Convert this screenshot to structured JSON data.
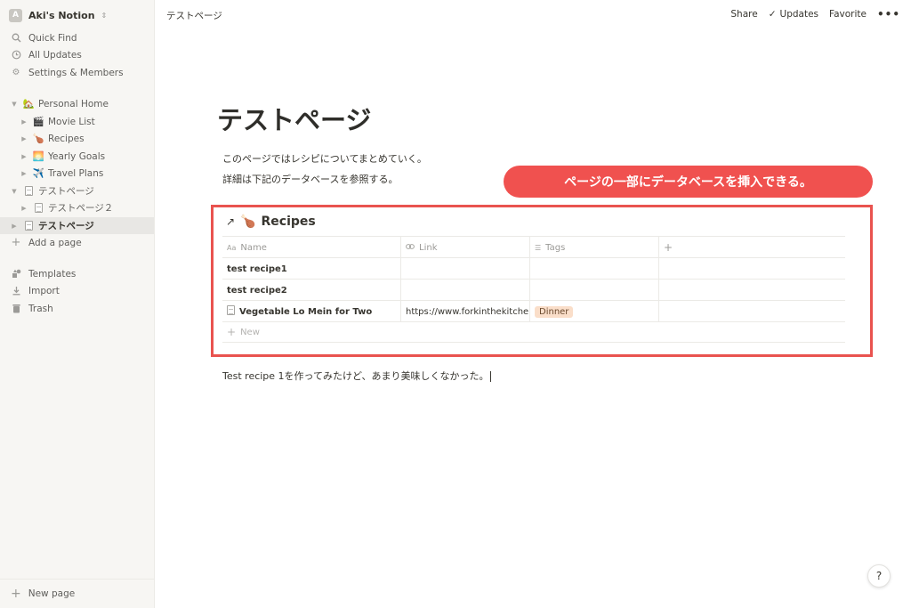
{
  "workspace": {
    "avatar": "A",
    "name": "Aki's Notion",
    "chevron_icon": "chevron-updown-icon"
  },
  "sidebar": {
    "top_items": [
      {
        "label": "Quick Find",
        "icon": "search-icon"
      },
      {
        "label": "All Updates",
        "icon": "clock-icon"
      },
      {
        "label": "Settings & Members",
        "icon": "gear-icon"
      }
    ],
    "pages": [
      {
        "label": "Personal Home",
        "emoji": "🏡",
        "expanded": true
      },
      {
        "label": "Movie List",
        "emoji": "🎬"
      },
      {
        "label": "Recipes",
        "emoji": "🍗"
      },
      {
        "label": "Yearly Goals",
        "emoji": "🌅"
      },
      {
        "label": "Travel Plans",
        "emoji": "✈️"
      },
      {
        "label": "テストページ",
        "icon": "page-icon",
        "expanded": true
      },
      {
        "label": "テストページ２",
        "icon": "page-icon"
      },
      {
        "label": "テストページ",
        "icon": "page-icon",
        "selected": true
      }
    ],
    "add_page": "Add a page",
    "bottom_items": [
      {
        "label": "Templates",
        "icon": "templates-icon"
      },
      {
        "label": "Import",
        "icon": "import-icon"
      },
      {
        "label": "Trash",
        "icon": "trash-icon"
      }
    ],
    "new_page": "New page"
  },
  "topbar": {
    "breadcrumb": "テストページ",
    "share": "Share",
    "updates": "Updates",
    "favorite": "Favorite",
    "more": "•••"
  },
  "page": {
    "title": "テストページ",
    "paragraphs": [
      "このページではレシピについてまとめていく。",
      "詳細は下記のデータベースを参照する。"
    ],
    "callout": "ページの一部にデータベースを挿入できる。",
    "closing": "Test recipe 1を作ってみたけど、あまり美味しくなかった。"
  },
  "database": {
    "link_arrow": "↗",
    "emoji": "🍗",
    "title": "Recipes",
    "headers": [
      {
        "icon": "Aa",
        "label": "Name"
      },
      {
        "icon": "link-icon",
        "label": "Link"
      },
      {
        "icon": "list-icon",
        "label": "Tags"
      },
      {
        "icon": "plus-icon",
        "label": "+"
      }
    ],
    "rows": [
      {
        "name": "test recipe1",
        "link": "",
        "tag": ""
      },
      {
        "name": "test recipe2",
        "link": "",
        "tag": ""
      },
      {
        "name": "Vegetable Lo Mein for Two",
        "link": "https://www.forkinthekitchen.c",
        "tag": "Dinner",
        "has_page_icon": true
      }
    ],
    "new_label": "New"
  },
  "help": "?",
  "colors": {
    "accent_red": "#f0514f",
    "sidebar_bg": "#f7f6f3",
    "tag_bg": "#fadec9"
  }
}
